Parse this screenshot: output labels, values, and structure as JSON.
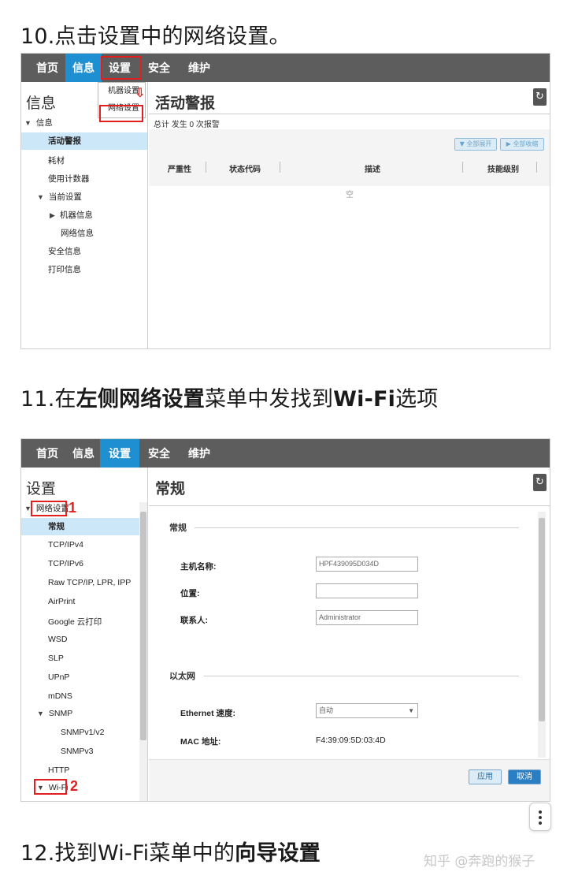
{
  "steps": {
    "step10": "10.点击设置中的网络设置。",
    "step11": {
      "p1": "11.在",
      "b1": "左侧网络设置",
      "p2": "菜单中发找到",
      "b2": "Wi-Fi",
      "p3": "选项"
    },
    "step12": {
      "p1": "12.找到Wi-Fi菜单中的",
      "b1": "向导设置"
    }
  },
  "nav": [
    "首页",
    "信息",
    "设置",
    "安全",
    "维护"
  ],
  "shot1": {
    "panel_title": "信息",
    "tree": [
      "信息",
      "活动警报",
      "耗材",
      "使用计数器",
      "当前设置",
      "机器信息",
      "网络信息",
      "安全信息",
      "打印信息"
    ],
    "dropdown": [
      "机器设置",
      "网络设置"
    ],
    "content_title": "活动警报",
    "summary": "总计  发生 0 次报警",
    "btn_expand": "▼ 全部展开",
    "btn_collapse": "▶ 全部收缩",
    "columns": [
      "严重性",
      "状态代码",
      "描述",
      "技能级别"
    ],
    "empty": "空"
  },
  "shot2": {
    "panel_title": "设置",
    "tree": [
      "网络设置",
      "常规",
      "TCP/IPv4",
      "TCP/IPv6",
      "Raw TCP/IP, LPR, IPP",
      "AirPrint",
      "Google 云打印",
      "WSD",
      "SLP",
      "UPnP",
      "mDNS",
      "SNMP",
      "SNMPv1/v2",
      "SNMPv3",
      "HTTP",
      "Wi-Fi"
    ],
    "content_title": "常规",
    "section_general": "常规",
    "host_label": "主机名称:",
    "host_value": "HPF439095D034D",
    "location_label": "位置:",
    "location_value": "",
    "contact_label": "联系人:",
    "contact_value": "Administrator",
    "section_ethernet": "以太网",
    "speed_label": "Ethernet 速度:",
    "speed_value": "自动",
    "mac_label": "MAC 地址:",
    "mac_value": "F4:39:09:5D:03:4D",
    "apply": "应用",
    "cancel": "取消",
    "marker1": "1",
    "marker2": "2"
  },
  "watermark": "知乎 @奔跑的猴子",
  "colors": {
    "nav_bg": "#5d5d5d",
    "nav_active": "#1e8fd0",
    "highlight": "#e02020",
    "selected_row": "#cce7f8"
  }
}
